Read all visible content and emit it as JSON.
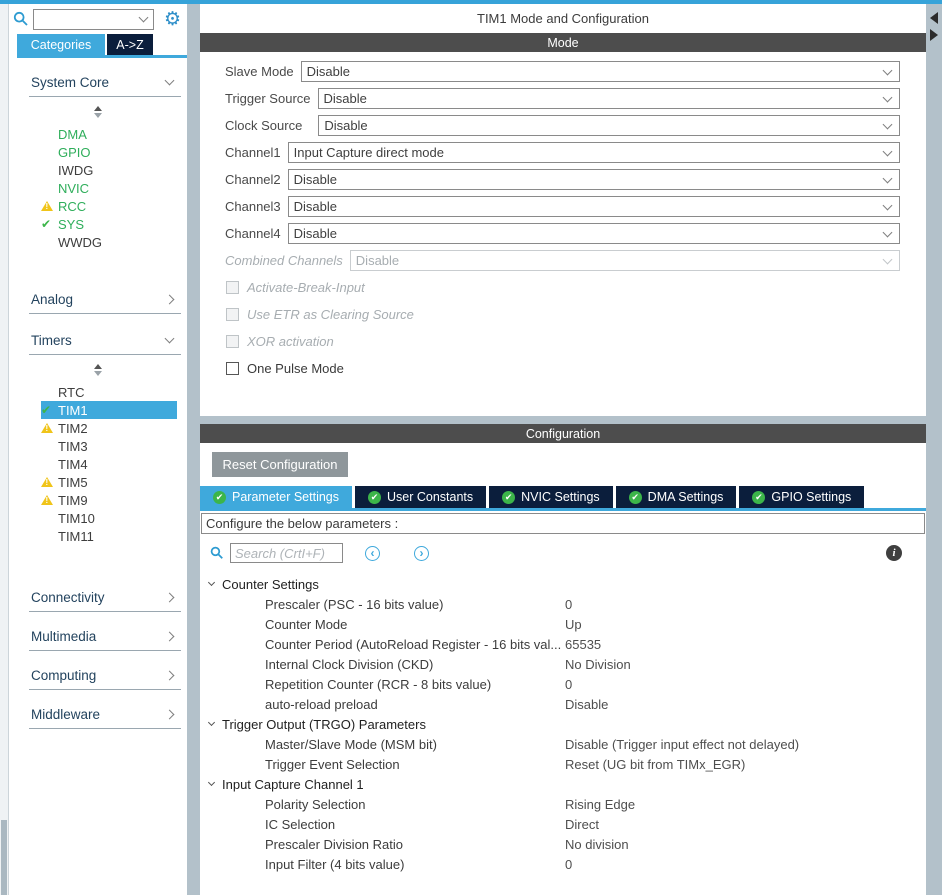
{
  "colors": {
    "accent": "#3fa9dc",
    "navy": "#0b1e3c",
    "green": "#3cb54a",
    "warning": "#f0c419",
    "header_gray": "#4d4d4d",
    "divider_gray": "#b3c1ca"
  },
  "icons": {
    "gear": "⚙",
    "check": "✔",
    "chevron_left_circle": "‹",
    "chevron_right_circle": "›",
    "info": "i"
  },
  "sidebar": {
    "search": {
      "value": ""
    },
    "tabs": [
      {
        "label": "Categories",
        "active": true
      },
      {
        "label": "A->Z",
        "active": false
      }
    ],
    "categories": [
      {
        "label": "System Core",
        "state": "expanded",
        "items": [
          {
            "label": "DMA",
            "color": "green",
            "icon": "none"
          },
          {
            "label": "GPIO",
            "color": "green",
            "icon": "none"
          },
          {
            "label": "IWDG",
            "color": "black",
            "icon": "none"
          },
          {
            "label": "NVIC",
            "color": "green",
            "icon": "none"
          },
          {
            "label": "RCC",
            "color": "green",
            "icon": "warning"
          },
          {
            "label": "SYS",
            "color": "green",
            "icon": "check"
          },
          {
            "label": "WWDG",
            "color": "black",
            "icon": "none"
          }
        ]
      },
      {
        "label": "Analog",
        "state": "collapsed",
        "items": []
      },
      {
        "label": "Timers",
        "state": "expanded",
        "items": [
          {
            "label": "RTC",
            "color": "black",
            "icon": "none"
          },
          {
            "label": "TIM1",
            "color": "selected",
            "icon": "check",
            "selected": true
          },
          {
            "label": "TIM2",
            "color": "black",
            "icon": "warning"
          },
          {
            "label": "TIM3",
            "color": "black",
            "icon": "none"
          },
          {
            "label": "TIM4",
            "color": "black",
            "icon": "none"
          },
          {
            "label": "TIM5",
            "color": "black",
            "icon": "warning"
          },
          {
            "label": "TIM9",
            "color": "black",
            "icon": "warning"
          },
          {
            "label": "TIM10",
            "color": "black",
            "icon": "none"
          },
          {
            "label": "TIM11",
            "color": "black",
            "icon": "none"
          }
        ]
      },
      {
        "label": "Connectivity",
        "state": "collapsed",
        "items": []
      },
      {
        "label": "Multimedia",
        "state": "collapsed",
        "items": []
      },
      {
        "label": "Computing",
        "state": "collapsed",
        "items": []
      },
      {
        "label": "Middleware",
        "state": "collapsed",
        "items": []
      }
    ]
  },
  "main": {
    "title": "TIM1 Mode and Configuration",
    "mode": {
      "header": "Mode",
      "rows": [
        {
          "label": "Slave Mode",
          "value": "Disable",
          "disabled": false
        },
        {
          "label": "Trigger Source",
          "value": "Disable",
          "disabled": false
        },
        {
          "label": "Clock Source",
          "value": "Disable",
          "disabled": false
        },
        {
          "label": "Channel1",
          "value": "Input Capture direct mode",
          "disabled": false
        },
        {
          "label": "Channel2",
          "value": "Disable",
          "disabled": false
        },
        {
          "label": "Channel3",
          "value": "Disable",
          "disabled": false
        },
        {
          "label": "Channel4",
          "value": "Disable",
          "disabled": false
        },
        {
          "label": "Combined Channels",
          "value": "Disable",
          "disabled": true
        }
      ],
      "checkboxes": [
        {
          "label": "Activate-Break-Input",
          "checked": false,
          "disabled": true
        },
        {
          "label": "Use ETR as Clearing Source",
          "checked": false,
          "disabled": true
        },
        {
          "label": "XOR activation",
          "checked": false,
          "disabled": true
        },
        {
          "label": "One Pulse Mode",
          "checked": false,
          "disabled": false
        }
      ]
    },
    "configuration": {
      "header": "Configuration",
      "reset_button": "Reset Configuration",
      "tabs": [
        {
          "label": "Parameter Settings",
          "active": true
        },
        {
          "label": "User Constants",
          "active": false
        },
        {
          "label": "NVIC Settings",
          "active": false
        },
        {
          "label": "DMA Settings",
          "active": false
        },
        {
          "label": "GPIO Settings",
          "active": false
        }
      ],
      "banner": "Configure the below parameters :",
      "search_placeholder": "Search (CrtI+F)",
      "tree": [
        {
          "section": "Counter Settings",
          "params": [
            {
              "name": "Prescaler (PSC - 16 bits value)",
              "value": "0"
            },
            {
              "name": "Counter Mode",
              "value": "Up"
            },
            {
              "name": "Counter Period (AutoReload Register - 16 bits val...",
              "value": "65535"
            },
            {
              "name": "Internal Clock Division (CKD)",
              "value": "No Division"
            },
            {
              "name": "Repetition Counter (RCR - 8 bits value)",
              "value": "0"
            },
            {
              "name": "auto-reload preload",
              "value": "Disable"
            }
          ]
        },
        {
          "section": "Trigger Output (TRGO) Parameters",
          "params": [
            {
              "name": "Master/Slave Mode (MSM bit)",
              "value": "Disable (Trigger input effect not delayed)"
            },
            {
              "name": "Trigger Event Selection",
              "value": "Reset (UG bit from TIMx_EGR)"
            }
          ]
        },
        {
          "section": "Input Capture Channel 1",
          "params": [
            {
              "name": "Polarity Selection",
              "value": "Rising Edge"
            },
            {
              "name": "IC Selection",
              "value": "Direct"
            },
            {
              "name": "Prescaler Division Ratio",
              "value": "No division"
            },
            {
              "name": "Input Filter (4 bits value)",
              "value": "0"
            }
          ]
        }
      ]
    }
  }
}
